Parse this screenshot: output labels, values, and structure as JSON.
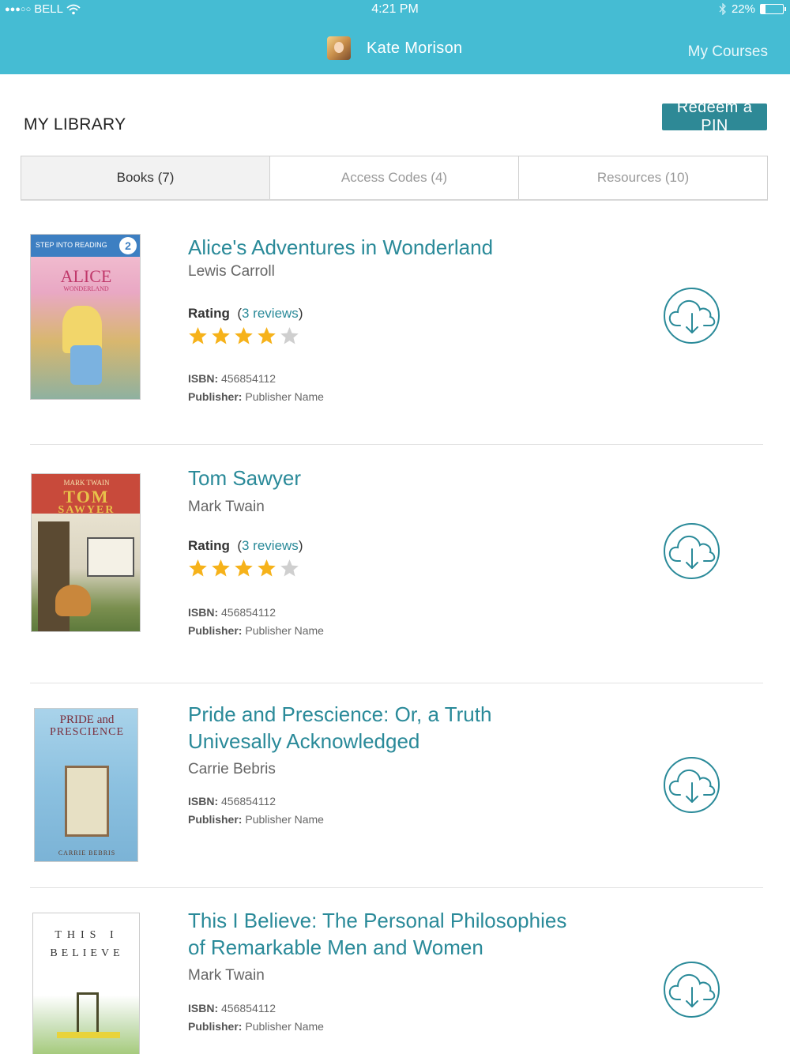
{
  "status": {
    "carrier": "BELL",
    "signal": "●●●○○",
    "time": "4:21 PM",
    "battery": "22%",
    "battery_level": 0.22
  },
  "header": {
    "user_name": "Kate Morison",
    "my_courses": "My Courses"
  },
  "library": {
    "title": "MY LIBRARY",
    "redeem_label": "Redeem a PIN"
  },
  "tabs": [
    {
      "label": "Books (7)",
      "active": true
    },
    {
      "label": "Access Codes (4)",
      "active": false
    },
    {
      "label": "Resources (10)",
      "active": false
    }
  ],
  "labels": {
    "rating": "Rating",
    "isbn": "ISBN:",
    "publisher": "Publisher:"
  },
  "books": [
    {
      "title_line1": "Alice's Adventures in Wonderland",
      "title_line2": "",
      "author": "Lewis Carroll",
      "reviews": "3 reviews",
      "rating": 4,
      "max_rating": 5,
      "isbn": "456854112",
      "publisher": "Publisher Name",
      "cover_text": [
        "STEP INTO READING",
        "2",
        "ALICE",
        "WONDERLAND"
      ]
    },
    {
      "title_line1": "Tom Sawyer",
      "title_line2": "",
      "author": "Mark Twain",
      "reviews": "3 reviews",
      "rating": 4,
      "max_rating": 5,
      "isbn": "456854112",
      "publisher": "Publisher Name",
      "cover_text": [
        "MARK TWAIN",
        "TOM",
        "SAWYER"
      ]
    },
    {
      "title_line1": "Pride and Prescience: Or, a Truth",
      "title_line2": "Univesally Acknowledged",
      "author": "Carrie Bebris",
      "isbn": "456854112",
      "publisher": "Publisher Name",
      "cover_text": [
        "PRIDE and",
        "PRESCIENCE",
        "CARRIE BEBRIS"
      ]
    },
    {
      "title_line1": "This I Believe: The Personal Philosophies",
      "title_line2": "of Remarkable Men and Women",
      "author": "Mark Twain",
      "isbn": "456854112",
      "publisher": "Publisher Name",
      "cover_text": [
        "THIS I",
        "BELIEVE"
      ]
    }
  ],
  "colors": {
    "header": "#45bcd3",
    "accent": "#2a8a99",
    "star_filled": "#f6b21a",
    "star_empty": "#cfcfcf"
  }
}
